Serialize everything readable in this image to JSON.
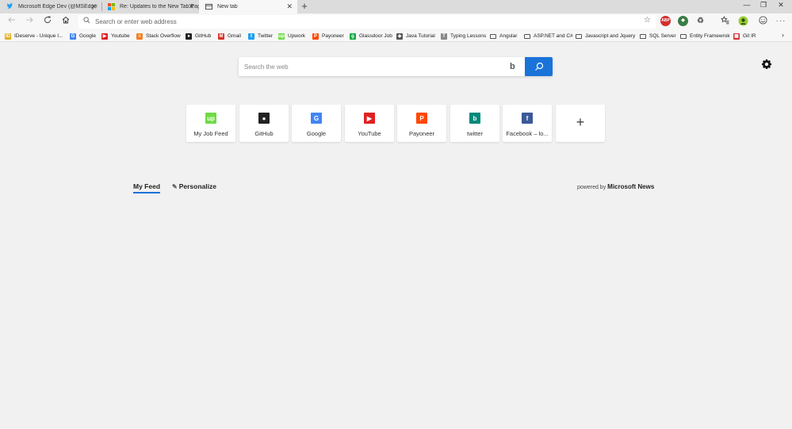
{
  "tabs": [
    {
      "label": "Microsoft Edge Dev (@MSEdgeD...",
      "icon": "twitter-icon"
    },
    {
      "label": "Re: Updates to the New Tab Page",
      "icon": "microsoft-icon"
    },
    {
      "label": "New tab",
      "icon": "newtab-icon"
    }
  ],
  "new_tab_symbol": "+",
  "window_controls": {
    "minimize": "—",
    "restore": "❐",
    "close": "✕"
  },
  "address": {
    "placeholder": "Search or enter web address"
  },
  "extensions": [
    {
      "name": "abp",
      "label": "ABP",
      "color": "#d32f2f"
    },
    {
      "name": "ext2",
      "label": "◆",
      "color": "#3a7d44"
    },
    {
      "name": "ext3",
      "label": "♻",
      "color": "#888888"
    }
  ],
  "bookmarks": [
    {
      "label": "IDeserve - Unique I...",
      "icon": "ID",
      "color": "#e0b020"
    },
    {
      "label": "Google",
      "icon": "G",
      "color": "#4285f4"
    },
    {
      "label": "Youtube",
      "icon": "▶",
      "color": "#e02020"
    },
    {
      "label": "Stack Overflow",
      "icon": "≡",
      "color": "#f48024"
    },
    {
      "label": "GitHub",
      "icon": "●",
      "color": "#222222"
    },
    {
      "label": "Gmail",
      "icon": "M",
      "color": "#d93025"
    },
    {
      "label": "Twitter",
      "icon": "t",
      "color": "#1da1f2"
    },
    {
      "label": "Upwork",
      "icon": "up",
      "color": "#6fda44"
    },
    {
      "label": "Payoneer",
      "icon": "P",
      "color": "#ff4800"
    },
    {
      "label": "Glassdoor Job",
      "icon": "g",
      "color": "#0caa41"
    },
    {
      "label": "Java Tutorial",
      "icon": "◈",
      "color": "#555555"
    },
    {
      "label": "Typing Lessons",
      "icon": "T",
      "color": "#888888"
    },
    {
      "label": "Angular",
      "folder": true
    },
    {
      "label": "ASP.NET and C#",
      "folder": true
    },
    {
      "label": "Javascript and Jquery",
      "folder": true
    },
    {
      "label": "SQL Server",
      "folder": true
    },
    {
      "label": "Entity Framewrok",
      "folder": true
    },
    {
      "label": "Git IR",
      "icon": "▦",
      "color": "#d32f2f"
    }
  ],
  "bookmarks_more": "›",
  "search": {
    "placeholder": "Search the web",
    "bing": "b"
  },
  "tiles": [
    {
      "label": "My Job Feed",
      "icon": "up",
      "color": "#6fda44"
    },
    {
      "label": "GitHub",
      "icon": "●",
      "color": "#222222"
    },
    {
      "label": "Google",
      "icon": "G",
      "color": "#4285f4"
    },
    {
      "label": "YouTube",
      "icon": "▶",
      "color": "#e02020"
    },
    {
      "label": "Payoneer",
      "icon": "P",
      "color": "#ff4800"
    },
    {
      "label": "twitter",
      "icon": "b",
      "color": "#00897b"
    },
    {
      "label": "Facebook – lo...",
      "icon": "f",
      "color": "#3b5998"
    }
  ],
  "add_tile": "+",
  "feed": {
    "my_feed": "My Feed",
    "personalize": "Personalize",
    "powered_by": "powered by",
    "provider": "Microsoft News"
  },
  "colors": {
    "accent": "#1a73d9"
  }
}
